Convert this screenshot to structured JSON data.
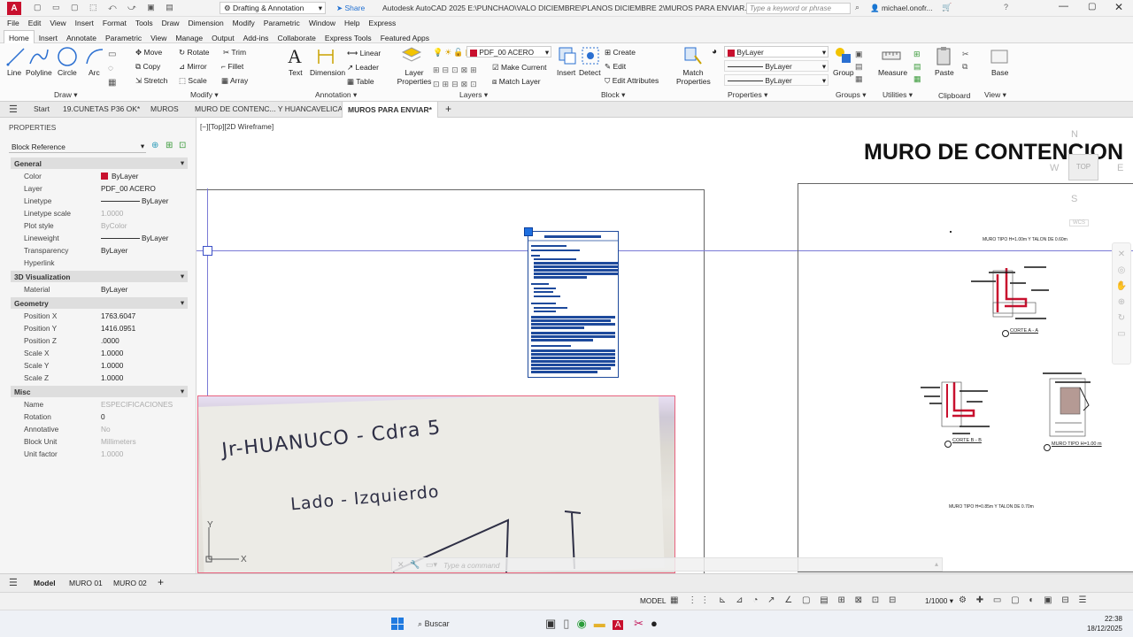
{
  "titlebar": {
    "app_letter": "A",
    "workspace": "Drafting & Annotation",
    "share": "Share",
    "title": "Autodesk AutoCAD 2025   E:\\PUNCHAO\\VALO DICIEMBRE\\PLANOS DICIEMBRE 2\\MUROS PARA ENVIAR.dwg",
    "search_placeholder": "Type a keyword or phrase",
    "user": "michael.onofr..."
  },
  "menu": [
    "File",
    "Edit",
    "View",
    "Insert",
    "Format",
    "Tools",
    "Draw",
    "Dimension",
    "Modify",
    "Parametric",
    "Window",
    "Help",
    "Express"
  ],
  "ribbon_tabs": [
    "Home",
    "Insert",
    "Annotate",
    "Parametric",
    "View",
    "Manage",
    "Output",
    "Add-ins",
    "Collaborate",
    "Express Tools",
    "Featured Apps"
  ],
  "ribbon": {
    "draw": {
      "title": "Draw",
      "line": "Line",
      "polyline": "Polyline",
      "circle": "Circle",
      "arc": "Arc"
    },
    "modify": {
      "title": "Modify",
      "move": "Move",
      "rotate": "Rotate",
      "trim": "Trim",
      "copy": "Copy",
      "mirror": "Mirror",
      "fillet": "Fillet",
      "stretch": "Stretch",
      "scale": "Scale",
      "array": "Array"
    },
    "annotation": {
      "title": "Annotation",
      "text": "Text",
      "dimension": "Dimension",
      "linear": "Linear",
      "leader": "Leader",
      "table": "Table"
    },
    "layers": {
      "title": "Layers",
      "layer_properties": "Layer Properties",
      "current_layer": "PDF_00 ACERO",
      "make_current": "Make Current",
      "match_layer": "Match Layer"
    },
    "block": {
      "title": "Block",
      "insert": "Insert",
      "detect": "Detect",
      "create": "Create",
      "edit": "Edit",
      "edit_attributes": "Edit Attributes"
    },
    "properties": {
      "title": "Properties",
      "match": "Match Properties",
      "color": "ByLayer",
      "linetype": "ByLayer",
      "lineweight": "ByLayer"
    },
    "groups": {
      "title": "Groups",
      "group": "Group"
    },
    "utilities": {
      "title": "Utilities",
      "measure": "Measure"
    },
    "clipboard": {
      "title": "Clipboard",
      "paste": "Paste"
    },
    "view": {
      "title": "View",
      "base": "Base"
    }
  },
  "doc_tabs": [
    "Start",
    "19.CUNETAS P36 OK*",
    "MUROS",
    "MURO DE CONTENC... Y HUANCAVELICA*",
    "MUROS PARA ENVIAR*"
  ],
  "properties_panel": {
    "title": "PROPERTIES",
    "selector": "Block Reference",
    "sections": {
      "general": "General",
      "viz": "3D Visualization",
      "geometry": "Geometry",
      "misc": "Misc"
    },
    "general": [
      {
        "k": "Color",
        "v": "ByLayer"
      },
      {
        "k": "Layer",
        "v": "PDF_00 ACERO"
      },
      {
        "k": "Linetype",
        "v": "ByLayer"
      },
      {
        "k": "Linetype scale",
        "v": "1.0000"
      },
      {
        "k": "Plot style",
        "v": "ByColor"
      },
      {
        "k": "Lineweight",
        "v": "ByLayer"
      },
      {
        "k": "Transparency",
        "v": "ByLayer"
      },
      {
        "k": "Hyperlink",
        "v": ""
      }
    ],
    "viz": [
      {
        "k": "Material",
        "v": "ByLayer"
      }
    ],
    "geometry": [
      {
        "k": "Position X",
        "v": "1763.6047"
      },
      {
        "k": "Position Y",
        "v": "1416.0951"
      },
      {
        "k": "Position Z",
        "v": ".0000"
      },
      {
        "k": "Scale X",
        "v": "1.0000"
      },
      {
        "k": "Scale Y",
        "v": "1.0000"
      },
      {
        "k": "Scale Z",
        "v": "1.0000"
      }
    ],
    "misc": [
      {
        "k": "Name",
        "v": "ESPECIFICACIONES"
      },
      {
        "k": "Rotation",
        "v": "0"
      },
      {
        "k": "Annotative",
        "v": "No"
      },
      {
        "k": "Block Unit",
        "v": "Millimeters"
      },
      {
        "k": "Unit factor",
        "v": "1.0000"
      }
    ]
  },
  "canvas": {
    "viewport_label": "[−][Top][2D Wireframe]",
    "drawing_title": "MURO DE CONTENCION",
    "note_line1": "Jr-HUANUCO - Cdra 5",
    "note_line2": "Lado - Izquierdo",
    "muro_tipo_1": "MURO TIPO H=1.00m Y TALON DE 0.60m",
    "corte_a": "CORTE A - A",
    "corte_b": "CORTE B - B",
    "muro_tipo_2": "MURO TIPO H=1.00 m",
    "muro_tipo_3": "MURO TIPO H=0.85m Y TALON DE 0.70m",
    "viewcube": {
      "n": "N",
      "s": "S",
      "w": "W",
      "e": "E",
      "top": "TOP",
      "wcs": "WCS"
    },
    "command_placeholder": "Type a command"
  },
  "layout_tabs": [
    "Model",
    "MURO 01",
    "MURO 02"
  ],
  "status": {
    "model": "MODEL",
    "scale": "1/1000"
  },
  "taskbar": {
    "search": "Buscar",
    "time": "22:38",
    "date": "18/12/2025"
  },
  "colors": {
    "accent": "#0078d4",
    "acad_red": "#c8102e",
    "selection": "#1e4a9c"
  }
}
